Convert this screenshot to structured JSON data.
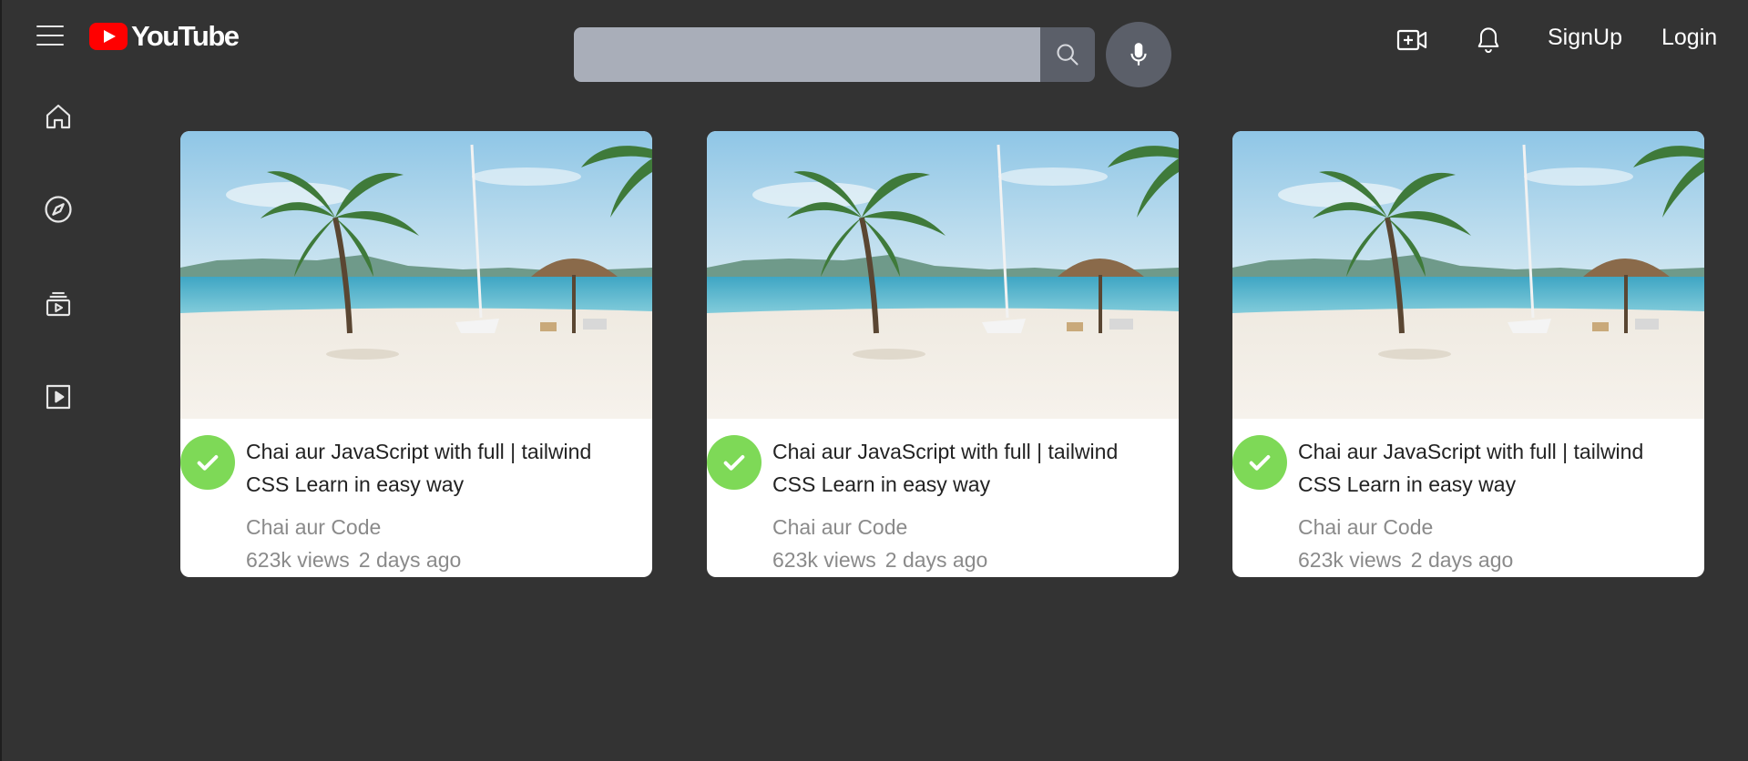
{
  "header": {
    "logo_text": "YouTube",
    "search": {
      "value": "",
      "placeholder": ""
    },
    "signup_label": "SignUp",
    "login_label": "Login"
  },
  "sidebar": {
    "items": [
      {
        "icon": "home-icon"
      },
      {
        "icon": "explore-icon"
      },
      {
        "icon": "subscriptions-icon"
      },
      {
        "icon": "library-icon"
      }
    ]
  },
  "videos": [
    {
      "title": "Chai aur JavaScript with full | tailwind CSS Learn in easy way",
      "channel": "Chai aur Code",
      "views": "623k views",
      "age": "2 days ago"
    },
    {
      "title": "Chai aur JavaScript with full | tailwind CSS Learn in easy way",
      "channel": "Chai aur Code",
      "views": "623k views",
      "age": "2 days ago"
    },
    {
      "title": "Chai aur JavaScript with full | tailwind CSS Learn in easy way",
      "channel": "Chai aur Code",
      "views": "623k views",
      "age": "2 days ago"
    }
  ],
  "colors": {
    "background": "#333333",
    "brand_red": "#ff0000",
    "search_bg": "#a9aeb9",
    "verified_green": "#7ed957"
  }
}
